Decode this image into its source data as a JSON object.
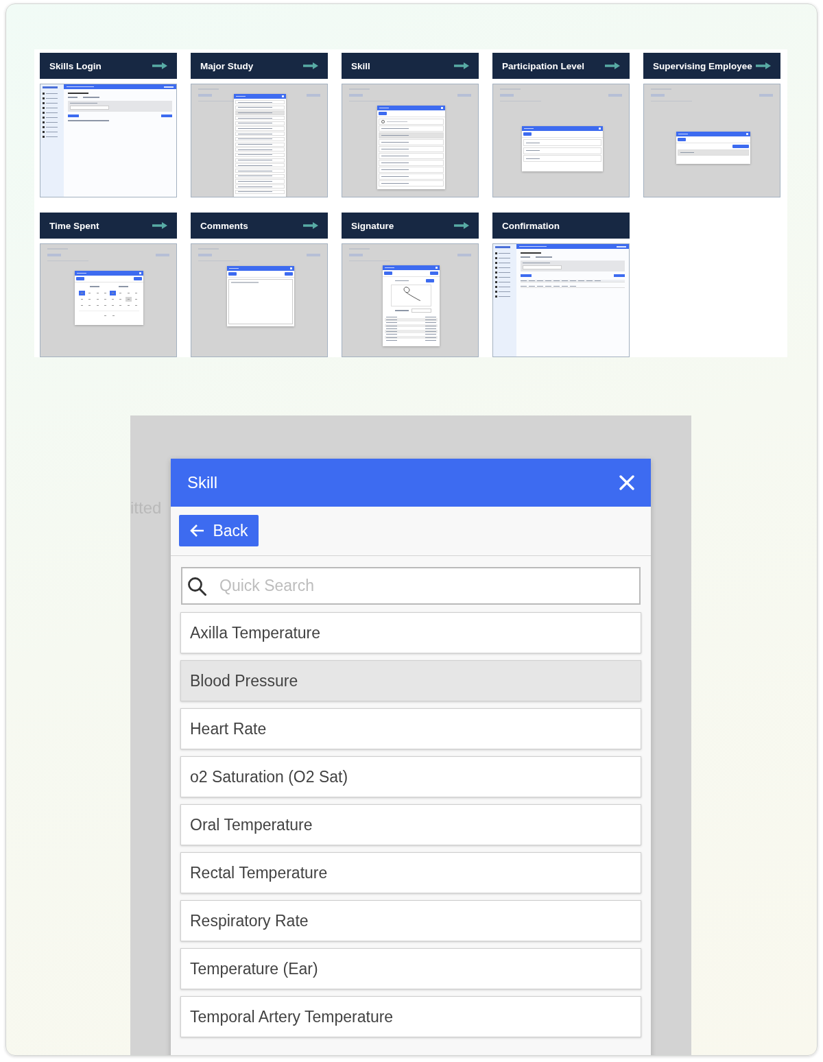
{
  "steps": [
    {
      "label": "Skills Login",
      "arrow": true,
      "kind": "login"
    },
    {
      "label": "Major Study",
      "arrow": true,
      "kind": "list"
    },
    {
      "label": "Skill",
      "arrow": true,
      "kind": "skill"
    },
    {
      "label": "Participation Level",
      "arrow": true,
      "kind": "options"
    },
    {
      "label": "Supervising Employee",
      "arrow": true,
      "kind": "employee"
    },
    {
      "label": "Time Spent",
      "arrow": true,
      "kind": "time"
    },
    {
      "label": "Comments",
      "arrow": true,
      "kind": "comments"
    },
    {
      "label": "Signature",
      "arrow": true,
      "kind": "signature"
    },
    {
      "label": "Confirmation",
      "arrow": false,
      "kind": "confirmation"
    }
  ],
  "background_text": "itted",
  "dialog": {
    "title": "Skill",
    "back_button": "Back",
    "search": {
      "placeholder": "Quick Search"
    },
    "items": [
      {
        "label": "Axilla Temperature",
        "selected": false
      },
      {
        "label": "Blood Pressure",
        "selected": true
      },
      {
        "label": "Heart Rate",
        "selected": false
      },
      {
        "label": "o2 Saturation (O2 Sat)",
        "selected": false
      },
      {
        "label": "Oral Temperature",
        "selected": false
      },
      {
        "label": "Rectal Temperature",
        "selected": false
      },
      {
        "label": "Respiratory Rate",
        "selected": false
      },
      {
        "label": "Temperature (Ear)",
        "selected": false
      },
      {
        "label": "Temporal Artery Temperature",
        "selected": false
      }
    ]
  }
}
